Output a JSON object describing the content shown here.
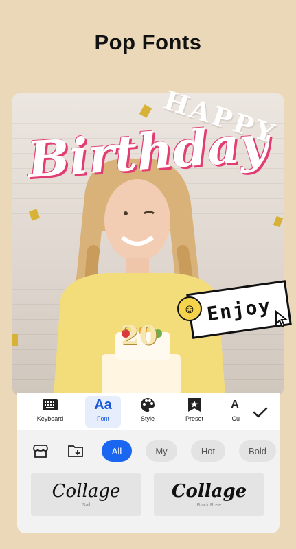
{
  "header": {
    "title": "Pop Fonts"
  },
  "canvas": {
    "birthday_text": "Birthday",
    "happy_text": "HAPPY",
    "enjoy_text": "Enjoy",
    "cake_number": "20"
  },
  "toolbar": {
    "tools": [
      {
        "label": "Keyboard",
        "icon": "keyboard-icon"
      },
      {
        "label": "Font",
        "icon": "font-icon",
        "glyph": "Aa"
      },
      {
        "label": "Style",
        "icon": "palette-icon"
      },
      {
        "label": "Preset",
        "icon": "preset-icon"
      },
      {
        "label": "Cu",
        "icon": "curve-icon"
      }
    ],
    "confirm_icon": "check-icon"
  },
  "filters": {
    "icons": [
      "store-icon",
      "folder-download-icon"
    ],
    "chips": [
      "All",
      "My",
      "Hot",
      "Bold"
    ],
    "active": "All"
  },
  "fonts": [
    {
      "sample": "Collage",
      "name": "Sail"
    },
    {
      "sample": "Collage",
      "name": "Black Rose"
    }
  ],
  "colors": {
    "accent": "#1a66f0",
    "background": "#ead8b9",
    "pink": "#e23d72"
  }
}
